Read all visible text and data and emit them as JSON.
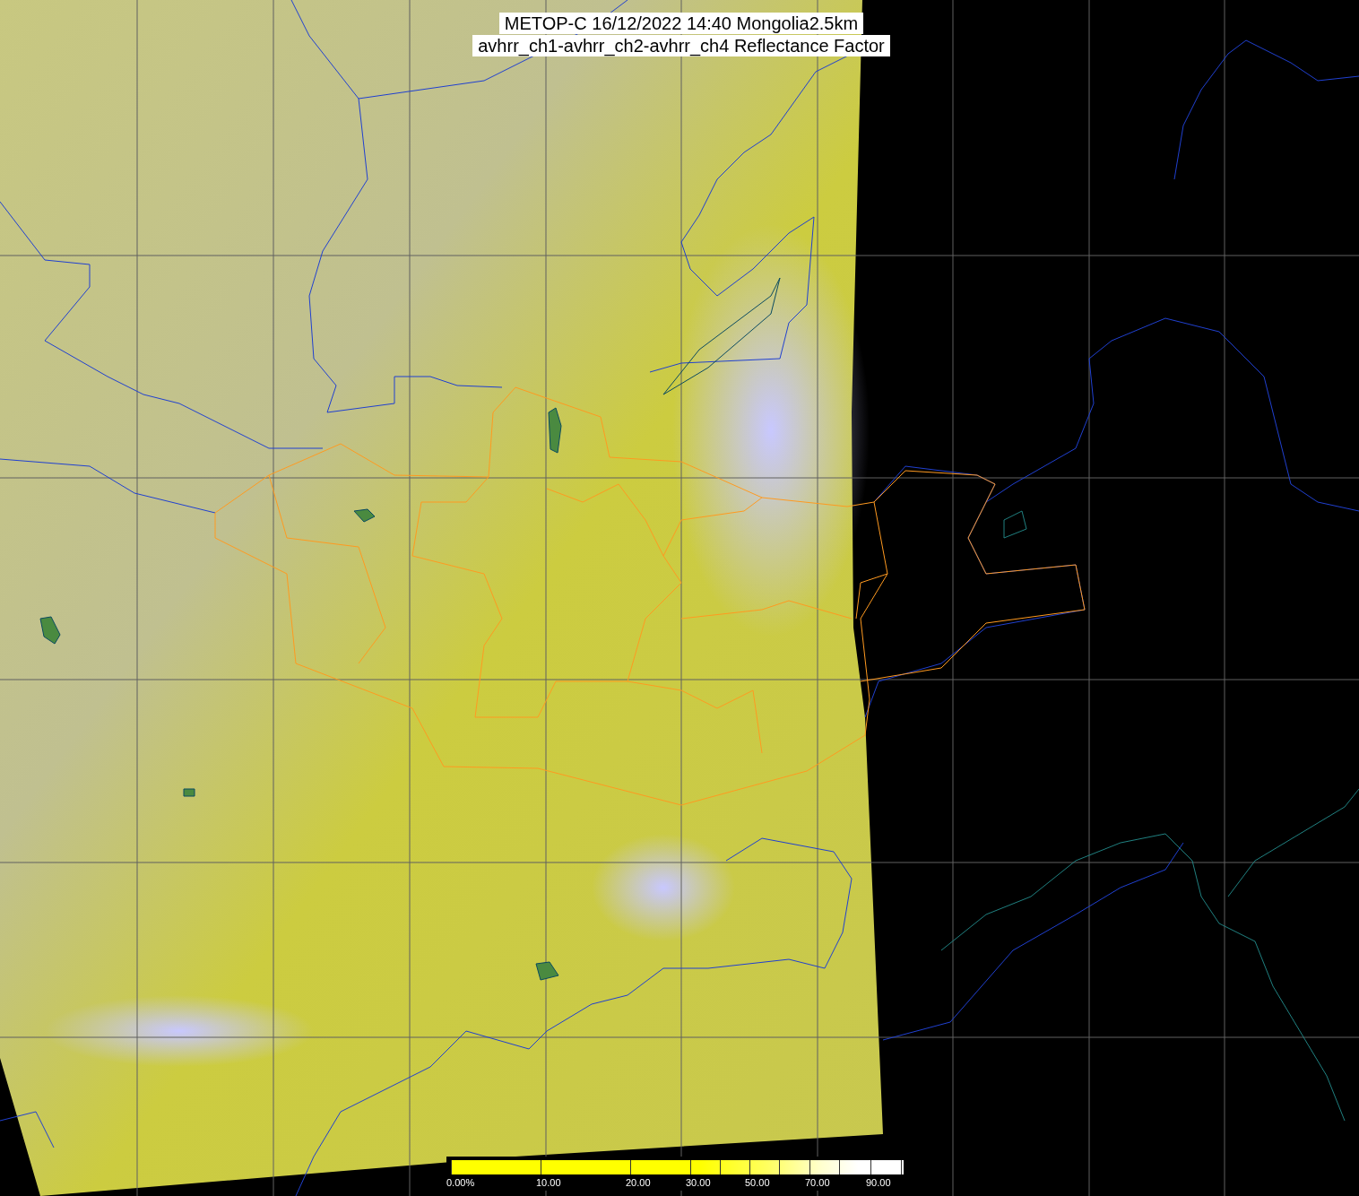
{
  "title": {
    "lines": [
      "METOP-C 16/12/2022 14:40 Mongolia2.5km",
      "avhrr_ch1-avhrr_ch2-avhrr_ch4 Reflectance Factor"
    ]
  },
  "colorbar": {
    "labels": [
      "0.00%",
      "10.00",
      "20.00",
      "30.00",
      "50.00",
      "70.00",
      "90.00"
    ]
  }
}
